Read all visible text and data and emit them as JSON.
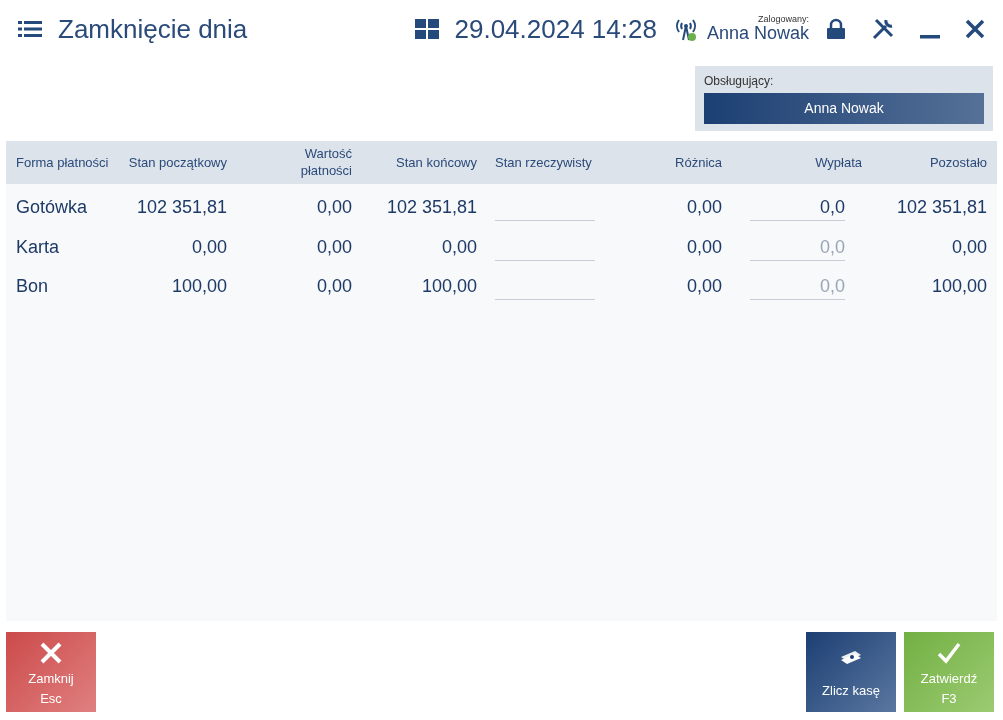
{
  "header": {
    "title": "Zamknięcie dnia",
    "datetime": "29.04.2024 14:28",
    "logged_label": "Zalogowany:",
    "user": "Anna Nowak"
  },
  "operator": {
    "label": "Obsługujący:",
    "value": "Anna Nowak"
  },
  "table": {
    "columns": [
      "Forma płatności",
      "Stan początkowy",
      "Wartość płatności",
      "Stan końcowy",
      "Stan rzeczywisty",
      "Różnica",
      "Wypłata",
      "Pozostało"
    ],
    "rows": [
      {
        "cells": [
          "Gotówka",
          "102 351,81",
          "0,00",
          "102 351,81"
        ],
        "difference": "0,00",
        "payout": {
          "value": "0,0"
        },
        "remaining": "102 351,81"
      },
      {
        "cells": [
          "Karta",
          "0,00",
          "0,00",
          "0,00"
        ],
        "difference": "0,00",
        "payout": {
          "placeholder": "0,0"
        },
        "remaining": "0,00"
      },
      {
        "cells": [
          "Bon",
          "100,00",
          "0,00",
          "100,00"
        ],
        "difference": "0,00",
        "payout": {
          "placeholder": "0,0"
        },
        "remaining": "100,00"
      }
    ]
  },
  "buttons": [
    {
      "kind": "close",
      "label": "Zamknij",
      "shortcut": "Esc"
    },
    {
      "kind": "count",
      "label": "Zlicz kasę"
    },
    {
      "kind": "confirm",
      "label": "Zatwierdź",
      "shortcut": "F3"
    }
  ]
}
